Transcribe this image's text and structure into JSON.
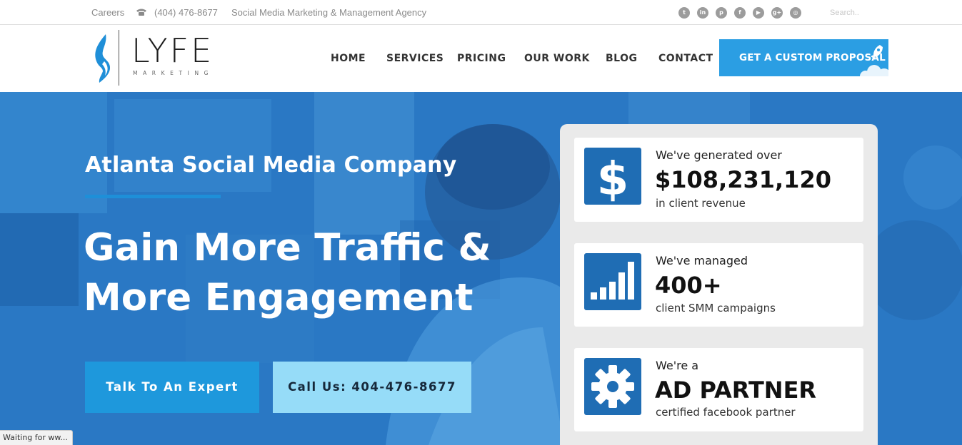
{
  "topbar": {
    "careers": "Careers",
    "phone": "(404) 476-8677",
    "tagline": "Social Media Marketing & Management Agency",
    "search_placeholder": "Search..",
    "social_icons": [
      "twitter-icon",
      "linkedin-icon",
      "pinterest-icon",
      "facebook-icon",
      "youtube-icon",
      "google-plus-icon",
      "instagram-icon"
    ]
  },
  "logo": {
    "name": "LYFE",
    "sub": "MARKETING"
  },
  "nav": {
    "items": [
      "HOME",
      "SERVICES",
      "PRICING",
      "OUR WORK",
      "BLOG",
      "CONTACT"
    ],
    "cta": "GET A CUSTOM PROPOSAL"
  },
  "hero": {
    "subtitle": "Atlanta Social Media Company",
    "title": "Gain More Traffic & More Engagement",
    "btn_expert": "Talk To An Expert",
    "btn_call": "Call Us: 404-476-8677"
  },
  "stats": [
    {
      "icon": "dollar-icon",
      "top": "We've generated over",
      "big": "$108,231,120",
      "bottom": "in client revenue"
    },
    {
      "icon": "bar-chart-icon",
      "top": "We've managed",
      "big": "400+",
      "bottom": "client SMM campaigns"
    },
    {
      "icon": "gear-icon",
      "top": "We're a",
      "big": "AD PARTNER",
      "bottom": "certified facebook partner"
    }
  ],
  "status_bar": "Waiting for ww...",
  "colors": {
    "brand_blue": "#2b9ee3",
    "hero_blue": "#2a78c4",
    "icon_blue": "#1f6db4",
    "light_button": "#96dcf8"
  }
}
